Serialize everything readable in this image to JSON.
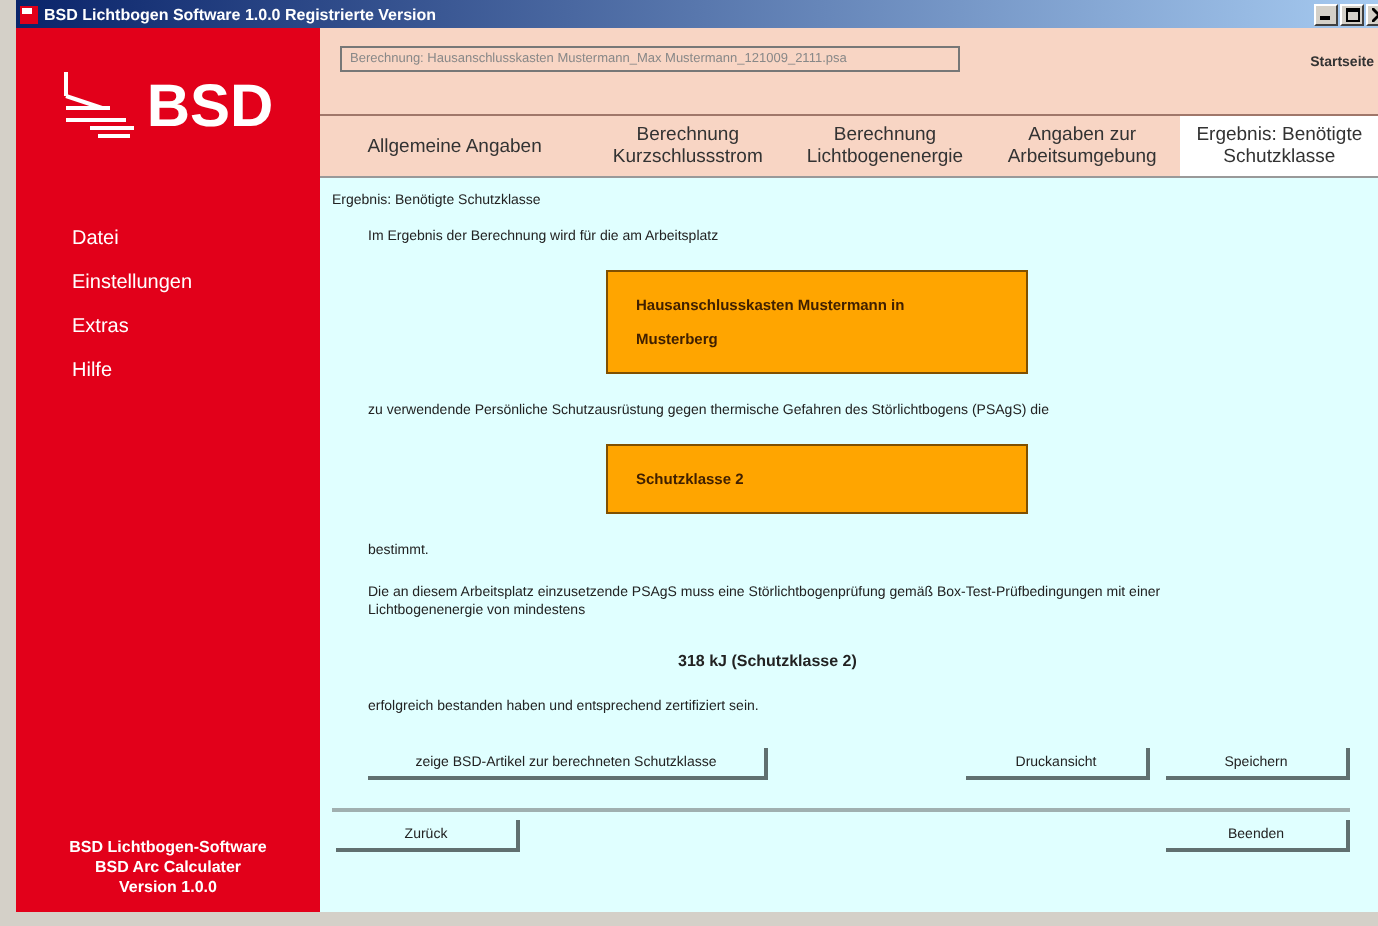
{
  "window": {
    "title": "BSD Lichtbogen Software 1.0.0 Registrierte Version"
  },
  "sidebar": {
    "logo_text": "BSD",
    "items": [
      {
        "label": "Datei"
      },
      {
        "label": "Einstellungen"
      },
      {
        "label": "Extras"
      },
      {
        "label": "Hilfe"
      }
    ],
    "footer": [
      "BSD Lichtbogen-Software",
      "BSD Arc Calculater",
      "Version 1.0.0"
    ]
  },
  "header": {
    "file_field": "Berechnung: Hausanschlusskasten Mustermann_Max Mustermann_121009_2111.psa",
    "home_link": "Startseite"
  },
  "tabs": [
    {
      "label": "Allgemeine Angaben",
      "selected": false
    },
    {
      "label": "Berechnung Kurzschlussstrom",
      "selected": false
    },
    {
      "label": "Berechnung Lichtbogenenergie",
      "selected": false
    },
    {
      "label": "Angaben zur Arbeitsumgebung",
      "selected": false
    },
    {
      "label": "Ergebnis: Benötigte Schutzklasse",
      "selected": true
    }
  ],
  "content": {
    "heading": "Ergebnis: Benötigte Schutzklasse",
    "blocks": [
      {
        "kind": "text",
        "text": "Im Ergebnis der Berechnung wird für die am Arbeitsplatz"
      },
      {
        "kind": "highlight",
        "text": "Hausanschlusskasten Mustermann in Musterberg"
      },
      {
        "kind": "text",
        "text": "zu verwendende Persönliche Schutzausrüstung gegen thermische Gefahren des Störlichtbogens (PSAgS) die"
      },
      {
        "kind": "highlight",
        "text": "Schutzklasse 2"
      },
      {
        "kind": "text",
        "text": "bestimmt."
      },
      {
        "kind": "text",
        "text": "Die an diesem Arbeitsplatz einzusetzende PSAgS muss eine Störlichtbogenprüfung gemäß Box-Test-Prüfbedingungen mit einer Lichtbogenenergie von mindestens"
      },
      {
        "kind": "result",
        "text": "318 kJ (Schutzklasse 2)"
      },
      {
        "kind": "text",
        "text": "erfolgreich bestanden haben und entsprechend zertifiziert sein."
      }
    ],
    "article_button": "zeige BSD-Artikel zur berechneten Schutzklasse",
    "print_button": "Druckansicht",
    "save_button": "Speichern",
    "back_button": "Zurück",
    "exit_button": "Beenden"
  }
}
